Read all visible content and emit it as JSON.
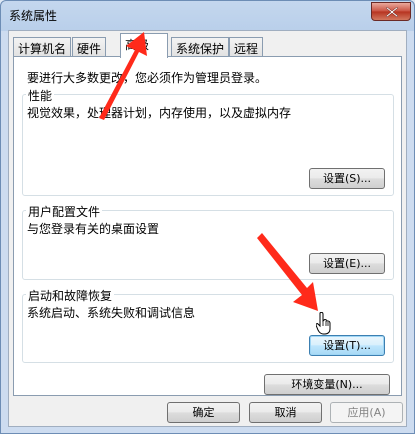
{
  "window": {
    "title": "系统属性",
    "close_icon": "close-icon"
  },
  "tabs": [
    {
      "label": "计算机名"
    },
    {
      "label": "硬件"
    },
    {
      "label": "高级",
      "active": true
    },
    {
      "label": "系统保护"
    },
    {
      "label": "远程"
    }
  ],
  "advanced": {
    "admin_note": "要进行大多数更改，您必须作为管理员登录。",
    "performance": {
      "title": "性能",
      "description": "视觉效果，处理器计划，内存使用，以及虚拟内存",
      "button": "设置(S)..."
    },
    "user_profiles": {
      "title": "用户配置文件",
      "description": "与您登录有关的桌面设置",
      "button": "设置(E)..."
    },
    "startup_recovery": {
      "title": "启动和故障恢复",
      "description": "系统启动、系统失败和调试信息",
      "button": "设置(T)..."
    },
    "env_button": "环境变量(N)..."
  },
  "footer": {
    "ok": "确定",
    "cancel": "取消",
    "apply": "应用(A)"
  },
  "colors": {
    "annotation_arrow": "#ff2a1a",
    "focus_border": "#3c7fb1"
  }
}
